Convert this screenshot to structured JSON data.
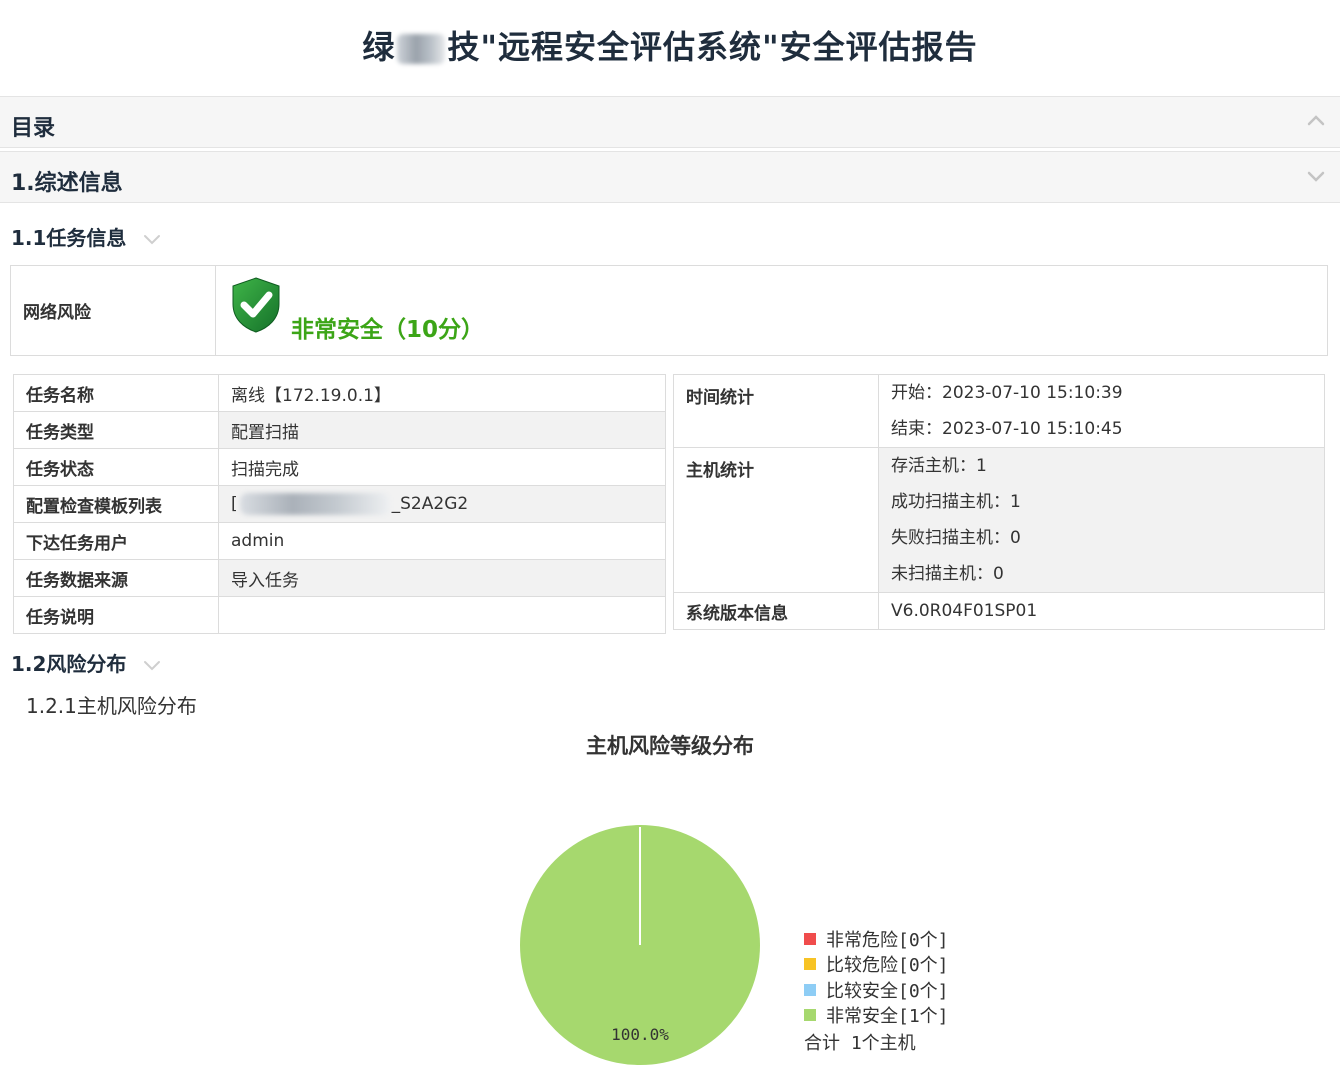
{
  "report": {
    "title_prefix": "绿",
    "title_suffix": "技\"远程安全评估系统\"安全评估报告"
  },
  "sections": {
    "toc": "目录",
    "overview": "1.综述信息"
  },
  "task_info": {
    "heading": "1.1任务信息",
    "risk_label": "网络风险",
    "risk_value": "非常安全（10分）",
    "left_rows": [
      {
        "key": "任务名称",
        "value": "离线【172.19.0.1】"
      },
      {
        "key": "任务类型",
        "value": "配置扫描"
      },
      {
        "key": "任务状态",
        "value": "扫描完成"
      },
      {
        "key": "配置检查模板列表",
        "value_prefix": "[",
        "value_suffix": "_S2A2G2"
      },
      {
        "key": "下达任务用户",
        "value": "admin"
      },
      {
        "key": "任务数据来源",
        "value": "导入任务"
      },
      {
        "key": "任务说明",
        "value": ""
      }
    ],
    "right": {
      "time_label": "时间统计",
      "time_start": "开始：2023-07-10 15:10:39",
      "time_end": "结束：2023-07-10 15:10:45",
      "host_label": "主机统计",
      "host_alive": "存活主机：1",
      "host_success": "成功扫描主机：1",
      "host_failed": "失败扫描主机：0",
      "host_unscanned": "未扫描主机：0",
      "version_label": "系统版本信息",
      "version_value": "V6.0R04F01SP01"
    }
  },
  "risk_dist": {
    "heading": "1.2风险分布",
    "subheading": "1.2.1主机风险分布"
  },
  "chart_data": {
    "type": "pie",
    "title": "主机风险等级分布",
    "categories": [
      "非常危险",
      "比较危险",
      "比较安全",
      "非常安全"
    ],
    "values": [
      0,
      0,
      0,
      1
    ],
    "legend_labels": [
      "非常危险[0个]",
      "比较危险[0个]",
      "比较安全[0个]",
      "非常安全[1个]"
    ],
    "colors": [
      "#f04c4c",
      "#f7c325",
      "#8ecdf5",
      "#a6d86e"
    ],
    "slice_label": "100.0%",
    "total_label": "合计  1个主机",
    "legend_position": "right"
  }
}
